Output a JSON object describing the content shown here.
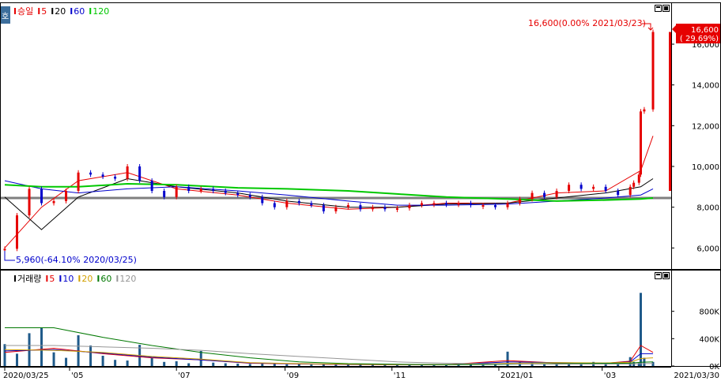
{
  "price_panel": {
    "side_tab": "호",
    "legend": [
      {
        "label": "승일",
        "color": "#e60000"
      },
      {
        "label": "5",
        "color": "#e60000"
      },
      {
        "label": "20",
        "color": "#000000"
      },
      {
        "label": "60",
        "color": "#0000cc"
      },
      {
        "label": "120",
        "color": "#00c800"
      }
    ],
    "max_annotation": "16,600(0.00% 2021/03/23)",
    "min_annotation": "5,960(-64.10% 2020/03/25)",
    "current_price": "16,600",
    "current_change": "( 29.69%)",
    "y_ticks": [
      "6,000",
      "8,000",
      "10,000",
      "12,000",
      "14,000",
      "16,000"
    ]
  },
  "volume_panel": {
    "legend": [
      {
        "label": "거래량",
        "color": "#000000"
      },
      {
        "label": "5",
        "color": "#e60000"
      },
      {
        "label": "10",
        "color": "#0000cc"
      },
      {
        "label": "20",
        "color": "#d2a000"
      },
      {
        "label": "60",
        "color": "#007800"
      },
      {
        "label": "120",
        "color": "#969696"
      }
    ],
    "y_ticks": [
      "0K",
      "400K",
      "800K"
    ]
  },
  "x_axis": {
    "labels": [
      "2020/03/25",
      "'05",
      "'07",
      "'09",
      "'11",
      "2021/01",
      "'03"
    ],
    "end_label": "2021/03/30"
  },
  "colors": {
    "up": "#e60000",
    "down": "#0000cc",
    "reference_line": "#7f7f7f",
    "ma5": "#e60000",
    "ma20": "#000000",
    "ma60": "#0000cc",
    "ma120": "#00c800"
  },
  "chart_data": [
    {
      "type": "line",
      "title": "",
      "ylim": [
        5200,
        17200
      ],
      "reference_level": 8450,
      "series": [
        {
          "name": "승일",
          "x": [
            "2020-03-25",
            "2020-04-01",
            "2020-04-08",
            "2020-04-15",
            "2020-04-22",
            "2020-04-29",
            "2020-05-06",
            "2020-05-13",
            "2020-05-20",
            "2020-05-27",
            "2020-06-03",
            "2020-06-10",
            "2020-06-17",
            "2020-06-24",
            "2020-07-01",
            "2020-07-08",
            "2020-07-15",
            "2020-07-22",
            "2020-07-29",
            "2020-08-05",
            "2020-08-12",
            "2020-08-19",
            "2020-08-26",
            "2020-09-02",
            "2020-09-09",
            "2020-09-16",
            "2020-09-23",
            "2020-09-30",
            "2020-10-07",
            "2020-10-14",
            "2020-10-21",
            "2020-10-28",
            "2020-11-04",
            "2020-11-11",
            "2020-11-18",
            "2020-11-25",
            "2020-12-02",
            "2020-12-09",
            "2020-12-16",
            "2020-12-23",
            "2020-12-30",
            "2021-01-06",
            "2021-01-13",
            "2021-01-20",
            "2021-01-27",
            "2021-02-03",
            "2021-02-10",
            "2021-02-17",
            "2021-02-24",
            "2021-03-03",
            "2021-03-10",
            "2021-03-17",
            "2021-03-19",
            "2021-03-22",
            "2021-03-23",
            "2021-03-25",
            "2021-03-30"
          ],
          "values": [
            5960,
            7600,
            8900,
            8200,
            8300,
            8800,
            9700,
            9600,
            9500,
            9400,
            10000,
            9300,
            8800,
            8500,
            9000,
            8800,
            8900,
            8800,
            8700,
            8600,
            8500,
            8200,
            8000,
            8300,
            8200,
            8100,
            7800,
            8000,
            8100,
            7900,
            8000,
            7900,
            7950,
            8100,
            8200,
            8200,
            8150,
            8200,
            8100,
            8100,
            8000,
            8200,
            8400,
            8700,
            8500,
            8800,
            9100,
            8900,
            9000,
            8800,
            8600,
            9000,
            9200,
            9600,
            12700,
            12800,
            16600
          ]
        },
        {
          "name": "5",
          "x": [
            "2020-03-25",
            "2020-04-15",
            "2020-05-06",
            "2020-06-03",
            "2020-07-01",
            "2020-08-05",
            "2020-09-02",
            "2020-10-07",
            "2020-11-04",
            "2020-12-02",
            "2021-01-06",
            "2021-02-03",
            "2021-03-03",
            "2021-03-23",
            "2021-03-30"
          ],
          "values": [
            6000,
            8000,
            9300,
            9700,
            8900,
            8600,
            8200,
            7900,
            8000,
            8200,
            8200,
            8700,
            8800,
            9800,
            11500
          ]
        },
        {
          "name": "20",
          "x": [
            "2020-03-25",
            "2020-04-15",
            "2020-05-06",
            "2020-06-03",
            "2020-07-01",
            "2020-08-05",
            "2020-09-02",
            "2020-10-07",
            "2020-11-04",
            "2020-12-02",
            "2021-01-06",
            "2021-02-03",
            "2021-03-03",
            "2021-03-23",
            "2021-03-30"
          ],
          "values": [
            8500,
            6900,
            8500,
            9400,
            9000,
            8700,
            8300,
            8000,
            8000,
            8150,
            8200,
            8450,
            8700,
            9000,
            9400
          ]
        },
        {
          "name": "60",
          "x": [
            "2020-03-25",
            "2020-04-15",
            "2020-05-06",
            "2020-06-03",
            "2020-07-01",
            "2020-08-05",
            "2020-09-02",
            "2020-10-07",
            "2020-11-04",
            "2020-12-02",
            "2021-01-06",
            "2021-02-03",
            "2021-03-03",
            "2021-03-23",
            "2021-03-30"
          ],
          "values": [
            9300,
            8900,
            8700,
            8900,
            9000,
            8800,
            8600,
            8300,
            8100,
            8100,
            8150,
            8300,
            8450,
            8600,
            8900
          ]
        },
        {
          "name": "120",
          "x": [
            "2020-03-25",
            "2020-04-15",
            "2020-05-06",
            "2020-06-03",
            "2020-07-01",
            "2020-08-05",
            "2020-09-02",
            "2020-10-07",
            "2020-11-04",
            "2020-12-02",
            "2021-01-06",
            "2021-02-03",
            "2021-03-03",
            "2021-03-23",
            "2021-03-30"
          ],
          "values": [
            9100,
            9000,
            9000,
            9150,
            9100,
            8950,
            8900,
            8800,
            8650,
            8500,
            8400,
            8300,
            8350,
            8400,
            8450
          ]
        }
      ]
    },
    {
      "type": "bar",
      "title": "",
      "ylim": [
        0,
        1200000
      ],
      "series": [
        {
          "name": "거래량",
          "x": [
            "2020-03-25",
            "2020-04-01",
            "2020-04-08",
            "2020-04-15",
            "2020-04-22",
            "2020-04-29",
            "2020-05-06",
            "2020-05-13",
            "2020-05-20",
            "2020-05-27",
            "2020-06-03",
            "2020-06-10",
            "2020-06-17",
            "2020-06-24",
            "2020-07-01",
            "2020-07-08",
            "2020-07-15",
            "2020-07-22",
            "2020-07-29",
            "2020-08-05",
            "2020-08-12",
            "2020-08-19",
            "2020-08-26",
            "2020-09-02",
            "2020-09-09",
            "2020-09-16",
            "2020-09-23",
            "2020-09-30",
            "2020-10-07",
            "2020-10-14",
            "2020-10-21",
            "2020-10-28",
            "2020-11-04",
            "2020-11-11",
            "2020-11-18",
            "2020-11-25",
            "2020-12-02",
            "2020-12-09",
            "2020-12-16",
            "2020-12-23",
            "2020-12-30",
            "2021-01-06",
            "2021-01-13",
            "2021-01-20",
            "2021-01-27",
            "2021-02-03",
            "2021-02-10",
            "2021-02-17",
            "2021-02-24",
            "2021-03-03",
            "2021-03-10",
            "2021-03-17",
            "2021-03-19",
            "2021-03-22",
            "2021-03-23",
            "2021-03-25",
            "2021-03-30"
          ],
          "values": [
            320000,
            180000,
            480000,
            560000,
            200000,
            120000,
            450000,
            300000,
            150000,
            90000,
            80000,
            310000,
            120000,
            60000,
            70000,
            40000,
            220000,
            50000,
            40000,
            35000,
            30000,
            45000,
            30000,
            25000,
            30000,
            20000,
            30000,
            25000,
            20000,
            18000,
            20000,
            18000,
            25000,
            16000,
            18000,
            17000,
            18000,
            15000,
            20000,
            15000,
            22000,
            210000,
            60000,
            40000,
            35000,
            50000,
            30000,
            45000,
            60000,
            40000,
            30000,
            130000,
            60000,
            45000,
            1070000,
            120000,
            60000
          ]
        },
        {
          "name": "5",
          "x": [
            "2020-03-25",
            "2020-04-22",
            "2020-05-20",
            "2020-06-17",
            "2020-07-15",
            "2020-08-12",
            "2020-09-09",
            "2020-10-07",
            "2020-11-04",
            "2020-12-02",
            "2021-01-06",
            "2021-02-03",
            "2021-03-03",
            "2021-03-17",
            "2021-03-23",
            "2021-03-30"
          ],
          "values": [
            200000,
            260000,
            180000,
            120000,
            90000,
            40000,
            30000,
            22000,
            20000,
            18000,
            80000,
            45000,
            40000,
            70000,
            300000,
            200000
          ]
        },
        {
          "name": "10",
          "x": [
            "2020-03-25",
            "2020-04-22",
            "2020-05-20",
            "2020-06-17",
            "2020-07-15",
            "2020-08-12",
            "2020-09-09",
            "2020-10-07",
            "2020-11-04",
            "2020-12-02",
            "2021-01-06",
            "2021-02-03",
            "2021-03-03",
            "2021-03-17",
            "2021-03-23",
            "2021-03-30"
          ],
          "values": [
            220000,
            240000,
            190000,
            130000,
            90000,
            45000,
            32000,
            23000,
            20000,
            18000,
            60000,
            50000,
            42000,
            60000,
            180000,
            180000
          ]
        },
        {
          "name": "20",
          "x": [
            "2020-03-25",
            "2020-04-22",
            "2020-05-20",
            "2020-06-17",
            "2020-07-15",
            "2020-08-12",
            "2020-09-09",
            "2020-10-07",
            "2020-11-04",
            "2020-12-02",
            "2021-01-06",
            "2021-02-03",
            "2021-03-03",
            "2021-03-17",
            "2021-03-23",
            "2021-03-30"
          ],
          "values": [
            240000,
            230000,
            200000,
            140000,
            100000,
            50000,
            35000,
            25000,
            21000,
            19000,
            40000,
            50000,
            45000,
            55000,
            110000,
            120000
          ]
        },
        {
          "name": "60",
          "x": [
            "2020-03-25",
            "2020-04-22",
            "2020-05-20",
            "2020-06-17",
            "2020-07-15",
            "2020-08-12",
            "2020-09-09",
            "2020-10-07",
            "2020-11-04",
            "2020-12-02",
            "2021-01-06",
            "2021-02-03",
            "2021-03-03",
            "2021-03-17",
            "2021-03-23",
            "2021-03-30"
          ],
          "values": [
            560000,
            560000,
            420000,
            300000,
            200000,
            120000,
            60000,
            35000,
            25000,
            20000,
            25000,
            35000,
            40000,
            42000,
            55000,
            60000
          ]
        },
        {
          "name": "120",
          "x": [
            "2020-03-25",
            "2020-04-22",
            "2020-05-20",
            "2020-06-17",
            "2020-07-15",
            "2020-08-12",
            "2020-09-09",
            "2020-10-07",
            "2020-11-04",
            "2020-12-02",
            "2021-01-06",
            "2021-02-03",
            "2021-03-03",
            "2021-03-17",
            "2021-03-23",
            "2021-03-30"
          ],
          "values": [
            300000,
            300000,
            280000,
            260000,
            230000,
            180000,
            140000,
            100000,
            60000,
            40000,
            30000,
            28000,
            28000,
            30000,
            35000,
            38000
          ]
        }
      ]
    }
  ]
}
